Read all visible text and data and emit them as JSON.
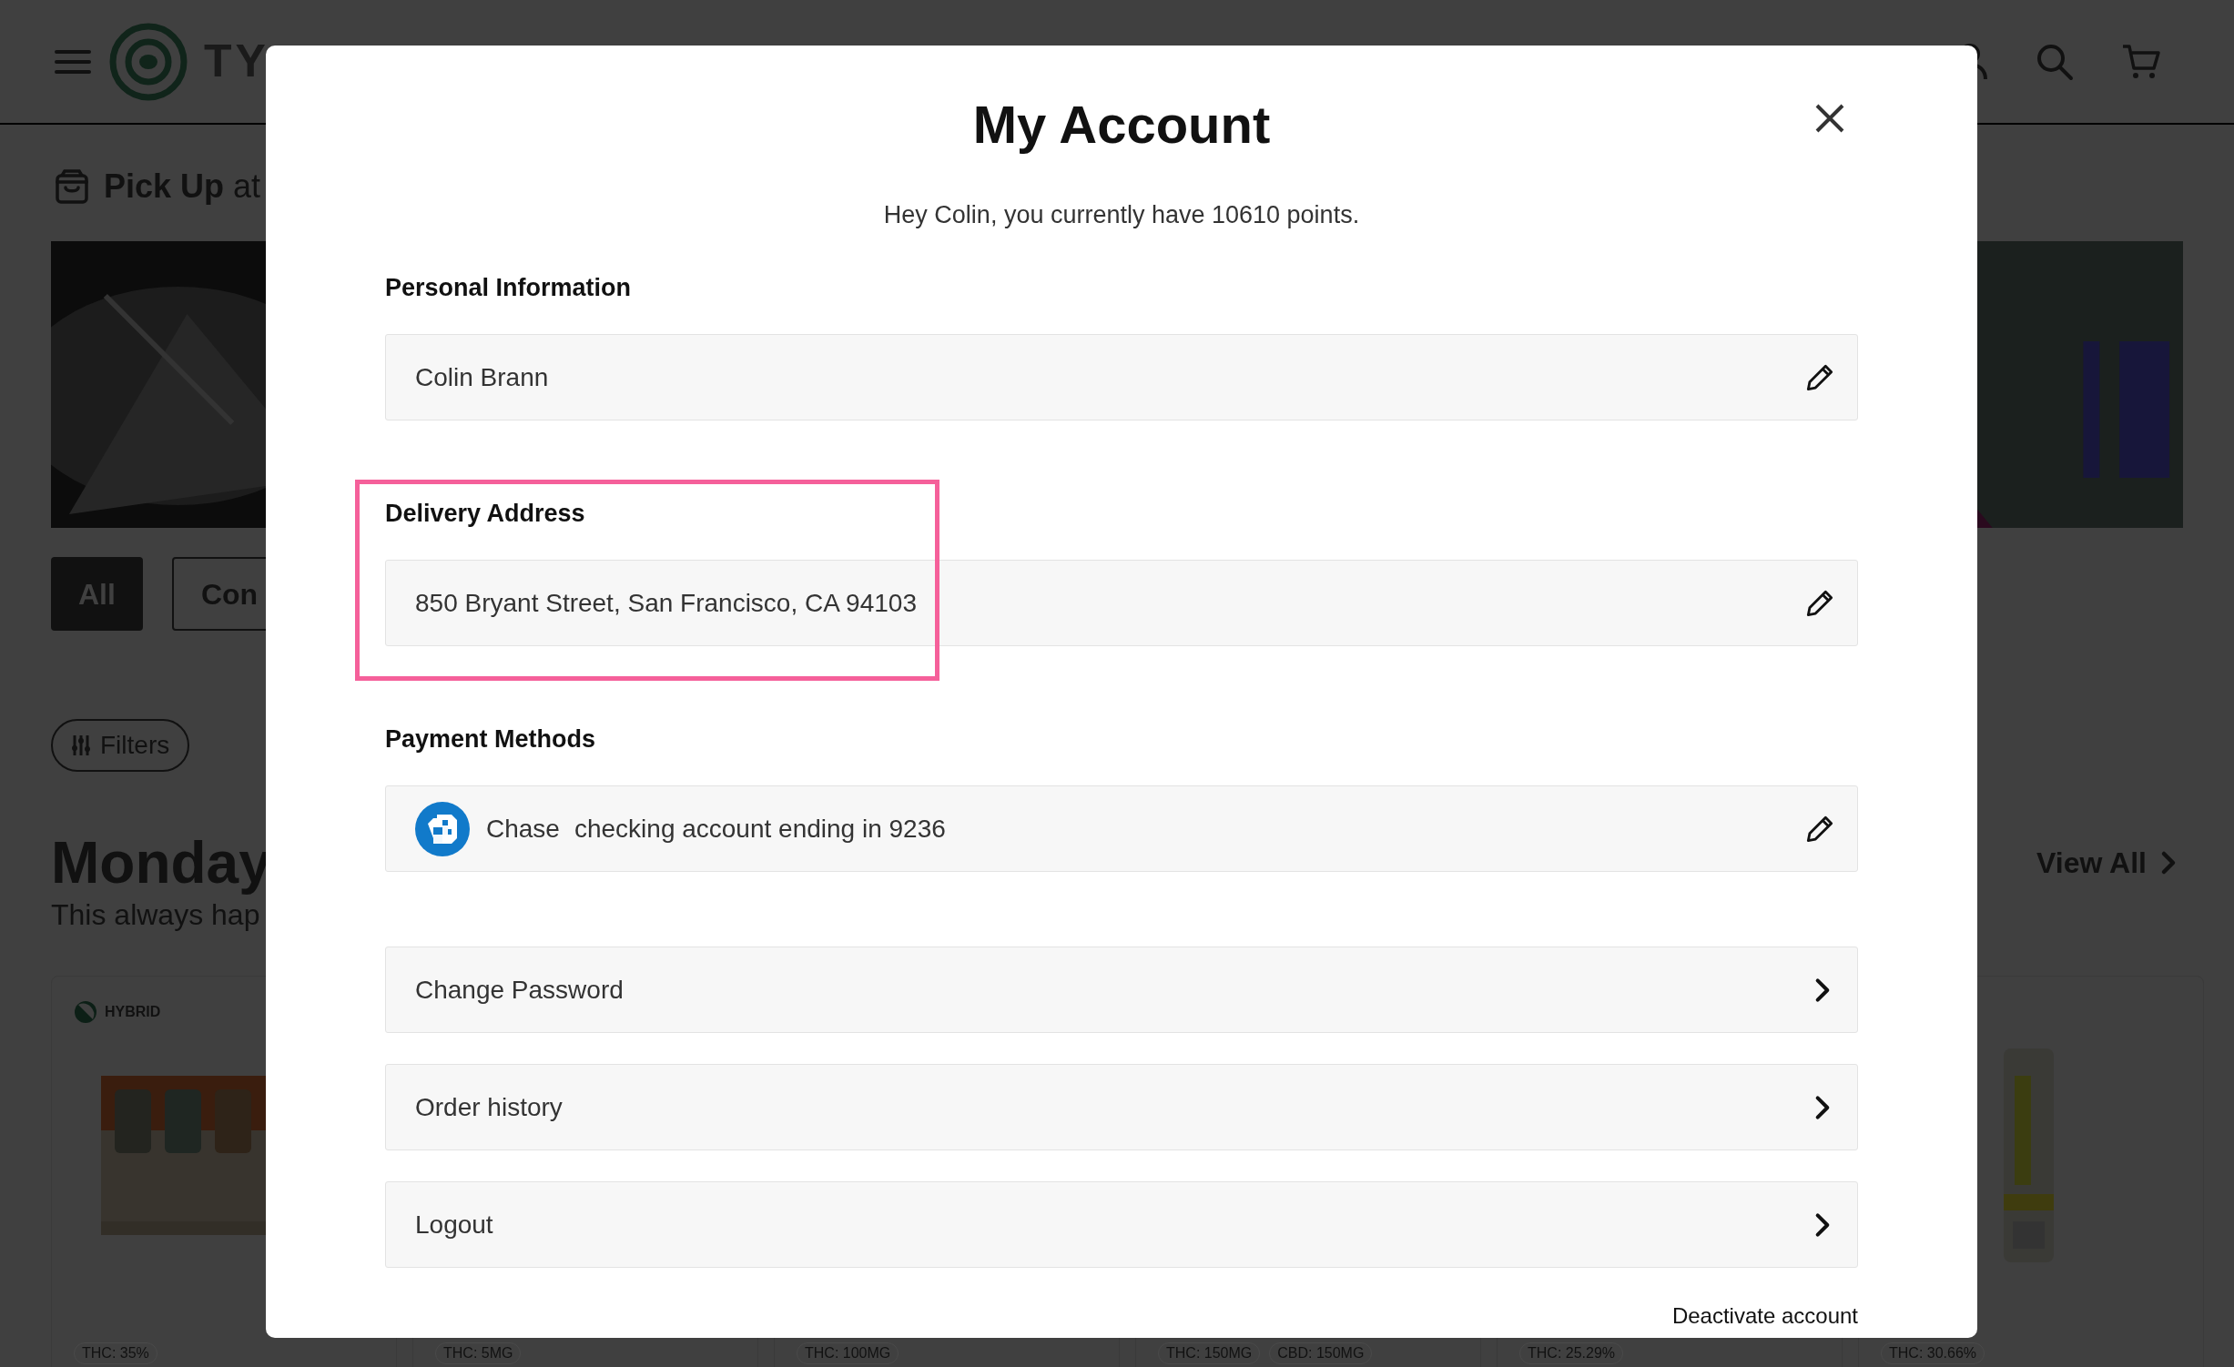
{
  "header": {
    "logo_text": "TY"
  },
  "page": {
    "pickup_bold": "Pick Up",
    "pickup_rest": "at",
    "categories": [
      {
        "label": "All",
        "selected": true
      },
      {
        "label": "Con",
        "selected": false
      }
    ],
    "filters_button": "Filters",
    "section_title": "Monday",
    "section_subtitle": "This always hap",
    "view_all": "View All",
    "products": [
      {
        "strain": "HYBRID",
        "image": {
          "kind": "picture"
        },
        "tags": [
          "THC: 35%"
        ]
      },
      {
        "tags": [
          "THC: 5MG"
        ]
      },
      {
        "tags": [
          "THC: 100MG"
        ]
      },
      {
        "tags": [
          "THC: 150MG",
          "CBD: 150MG"
        ]
      },
      {
        "tags": [
          "THC: 25.29%"
        ]
      },
      {
        "image": {
          "kind": "picture"
        },
        "tags": [
          "THC: 30.66%"
        ]
      }
    ]
  },
  "modal": {
    "title": "My Account",
    "greeting": "Hey Colin, you currently have 10610 points.",
    "sections": [
      {
        "kind": "field",
        "label": "Personal Information",
        "value": "Colin Brann",
        "highlighted": false
      },
      {
        "kind": "field",
        "label": "Delivery Address",
        "value": "850 Bryant Street, San Francisco, CA 94103",
        "highlighted": true
      },
      {
        "kind": "payment",
        "label": "Payment Methods",
        "bank": "Chase",
        "value": "checking account ending in 9236",
        "highlighted": false
      }
    ],
    "links": [
      "Change Password",
      "Order history",
      "Logout"
    ],
    "deactivate": "Deactivate account"
  }
}
